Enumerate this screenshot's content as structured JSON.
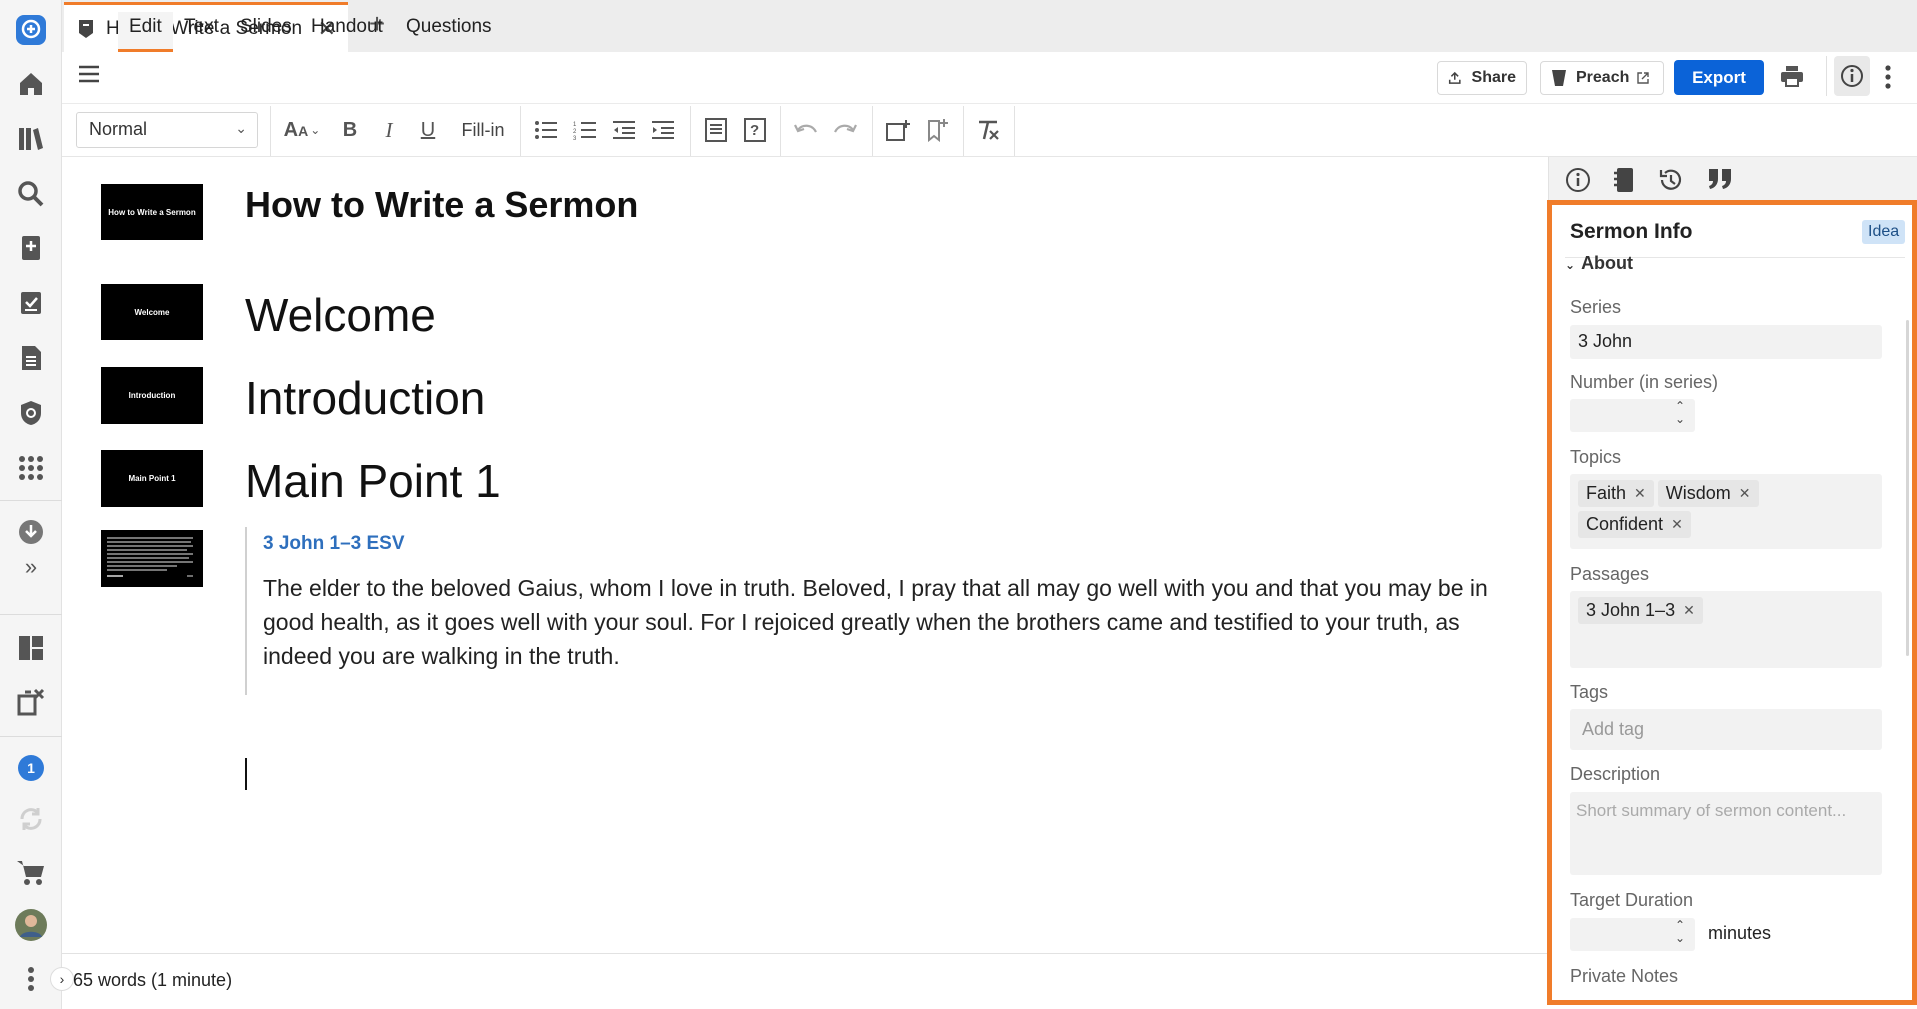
{
  "app": {
    "tab_title": "How to Write a Sermon",
    "close_glyph": "✕",
    "new_tab_glyph": "+"
  },
  "menu": {
    "items": [
      "Edit",
      "Text",
      "Slides",
      "Handout",
      "Questions"
    ],
    "share": "Share",
    "preach": "Preach",
    "export": "Export"
  },
  "toolbar": {
    "style_value": "Normal",
    "fill_in": "Fill-in"
  },
  "editor": {
    "title": "How to Write a Sermon",
    "sections": [
      "Welcome",
      "Introduction",
      "Main Point 1"
    ],
    "thumbs": {
      "title": "How to Write a Sermon",
      "welcome": "Welcome",
      "intro": "Introduction",
      "main1": "Main Point 1"
    },
    "scripture": {
      "reference": "3 John 1–3 ESV",
      "text": "The elder to the beloved Gaius, whom I love in truth. Beloved, I pray that all may go well with you and that you may be in good health, as it goes well with your soul. For I rejoiced greatly when the brothers came and testified to your truth, as indeed you are walking in the truth."
    },
    "word_count": "65 words (1 minute)"
  },
  "rail": {
    "notification_count": "1"
  },
  "panel": {
    "title": "Sermon Info",
    "badge": "Idea",
    "section": "About",
    "series_label": "Series",
    "series_value": "3 John",
    "number_label": "Number (in series)",
    "topics_label": "Topics",
    "topics": [
      "Faith",
      "Wisdom",
      "Confident"
    ],
    "passages_label": "Passages",
    "passages": [
      "3 John 1–3"
    ],
    "tags_label": "Tags",
    "tags_placeholder": "Add tag",
    "description_label": "Description",
    "description_placeholder": "Short summary of sermon content...",
    "duration_label": "Target Duration",
    "duration_unit": "minutes",
    "notes_label": "Private Notes"
  },
  "colors": {
    "accent": "#f07c2a",
    "primary_button": "#0b63d8",
    "link": "#2e6fbd",
    "rail_blue": "#2f7ad8"
  },
  "icons": {
    "rail": [
      "logo-icon",
      "home-icon",
      "library-icon",
      "search-icon",
      "add-note-icon",
      "checklist-icon",
      "document-icon",
      "shield-icon",
      "apps-icon",
      "download-icon",
      "expand-icon",
      "layout-icon",
      "copy-close-icon",
      "badge-icon",
      "sync-icon",
      "cart-icon",
      "avatar",
      "more-icon"
    ]
  }
}
